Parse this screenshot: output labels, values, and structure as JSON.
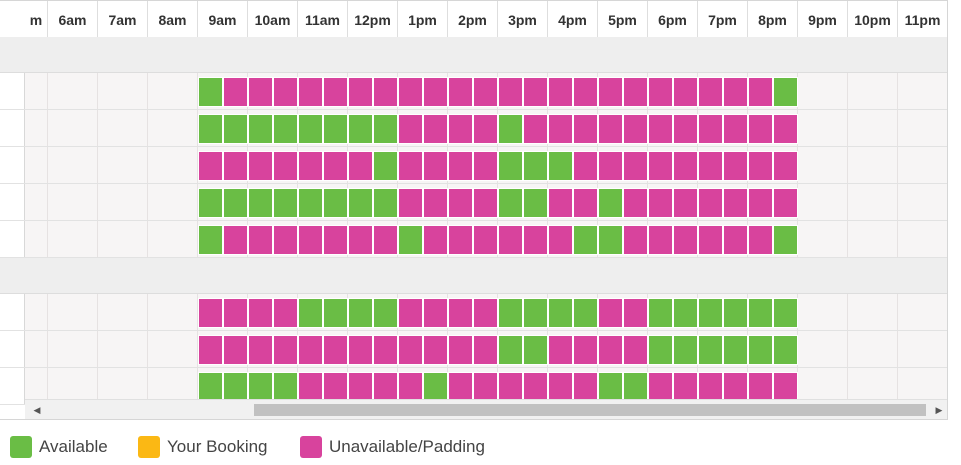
{
  "schedule": {
    "hours": [
      "m",
      "6am",
      "7am",
      "8am",
      "9am",
      "10am",
      "11am",
      "12pm",
      "1pm",
      "2pm",
      "3pm",
      "4pm",
      "5pm",
      "6pm",
      "7pm",
      "8pm",
      "9pm",
      "10pm",
      "11pm"
    ],
    "rows": [
      {
        "type": "band"
      },
      {
        "type": "slots",
        "pattern": "GPPPPPPPPPPPPPPPPPPPPPPG"
      },
      {
        "type": "slots",
        "pattern": "GGGGGGGGPPPPGPPPPPPPPPPP"
      },
      {
        "type": "slots",
        "pattern": "PPPPPPPGPPPPGGGPPPPPPPPP"
      },
      {
        "type": "slots",
        "pattern": "GGGGGGGGPPPPGGPPGPPPPPPP"
      },
      {
        "type": "slots",
        "pattern": "GPPPPPPPGPPPPPPGGPPPPPPG"
      },
      {
        "type": "band"
      },
      {
        "type": "slots",
        "pattern": "PPPPGGGGPPPPGGGGPPGGGGGG"
      },
      {
        "type": "slots",
        "pattern": "PPPPPPPPPPPPGGPPPPGGGGGG"
      },
      {
        "type": "slots",
        "pattern": "GGGGPPPPPGPPPPPPGGPPPPPP"
      }
    ]
  },
  "colors": {
    "available": "#6abd45",
    "booking": "#fbb814",
    "unavailable": "#d8439d"
  },
  "scrollbar": {
    "left_arrow_icon": "◀",
    "right_arrow_icon": "▶"
  },
  "legend": {
    "available_label": "Available",
    "booking_label": "Your Booking",
    "unavailable_label": "Unavailable/Padding"
  }
}
